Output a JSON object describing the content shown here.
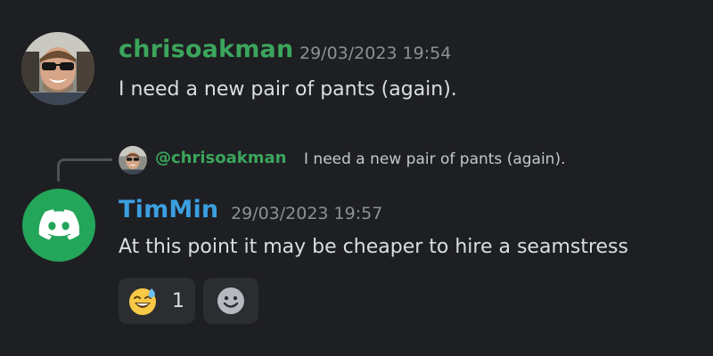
{
  "messages": [
    {
      "username": "chrisoakman",
      "username_color": "#3ba55c",
      "timestamp": "29/03/2023 19:54",
      "text": "I need a new pair of pants (again)."
    },
    {
      "reply": {
        "mention": "@chrisoakman",
        "text": "I need a new pair of pants (again)."
      },
      "username": "TimMin",
      "username_color": "#3b9fe0",
      "timestamp": "29/03/2023 19:57",
      "text": "At this point it may be cheaper to hire a seamstress",
      "reactions": [
        {
          "emoji": "sweat-smile-icon",
          "count": "1"
        }
      ],
      "add_reaction_icon": "add-reaction-smiley-icon"
    }
  ],
  "colors": {
    "background": "#1e1f22",
    "discord_green": "#23a55a",
    "reaction_bg": "#2b2d31"
  }
}
